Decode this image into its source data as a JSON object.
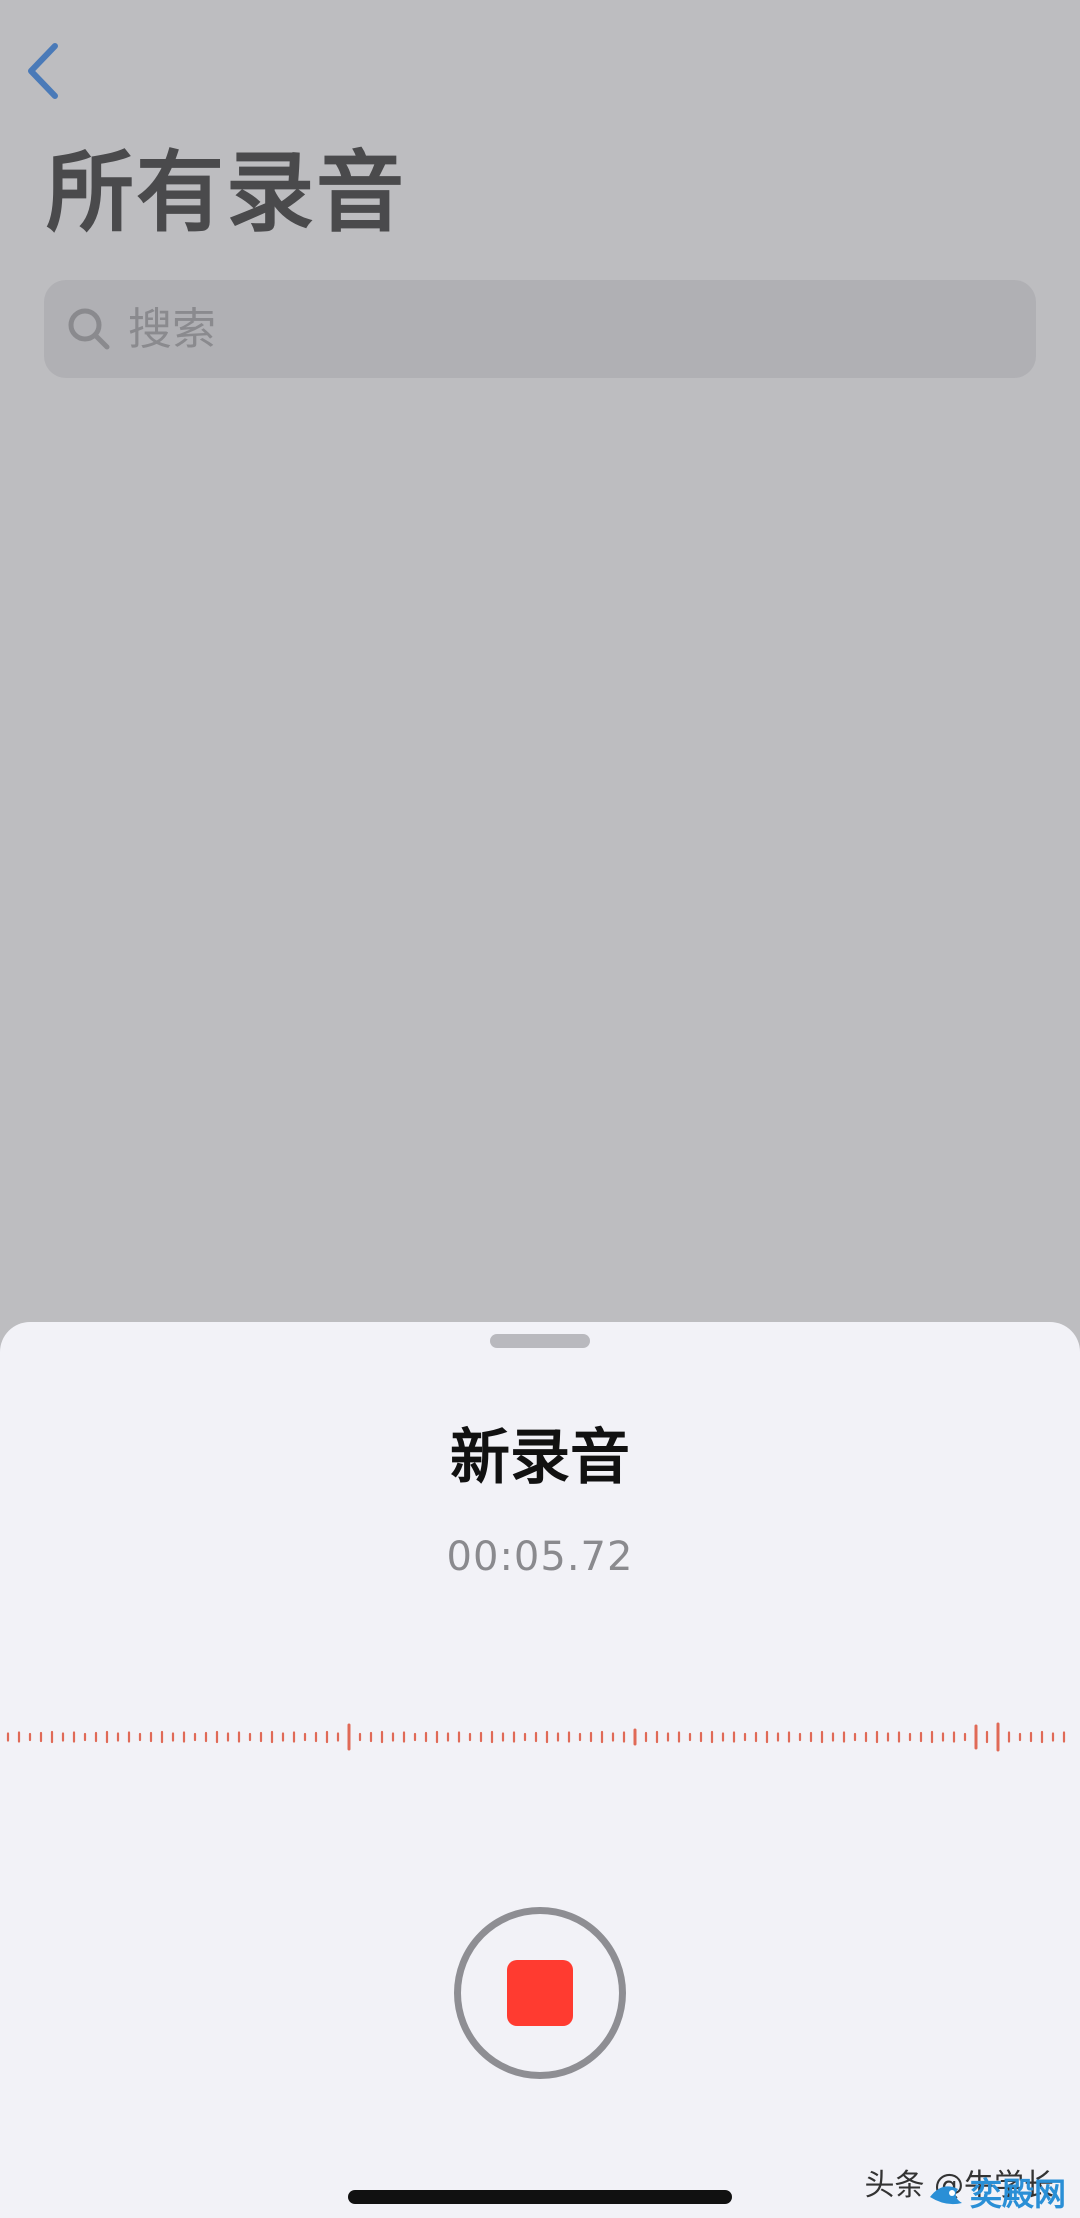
{
  "list_screen": {
    "title": "所有录音",
    "search": {
      "placeholder": "搜索",
      "icon": "magnifying-glass"
    },
    "back_icon": "chevron-left"
  },
  "recording_sheet": {
    "title": "新录音",
    "elapsed_time": "00:05.72",
    "stop_button_icon": "stop-square",
    "waveform_color": "#e06a57",
    "stop_color": "#ff3b30"
  },
  "watermark": {
    "text": "头条 @牛学长",
    "logo_text": "奕殿网"
  },
  "colors": {
    "accent": "#4a7ab8",
    "dimmed_background": "#bdbdc0",
    "sheet_background": "#f2f2f7"
  }
}
